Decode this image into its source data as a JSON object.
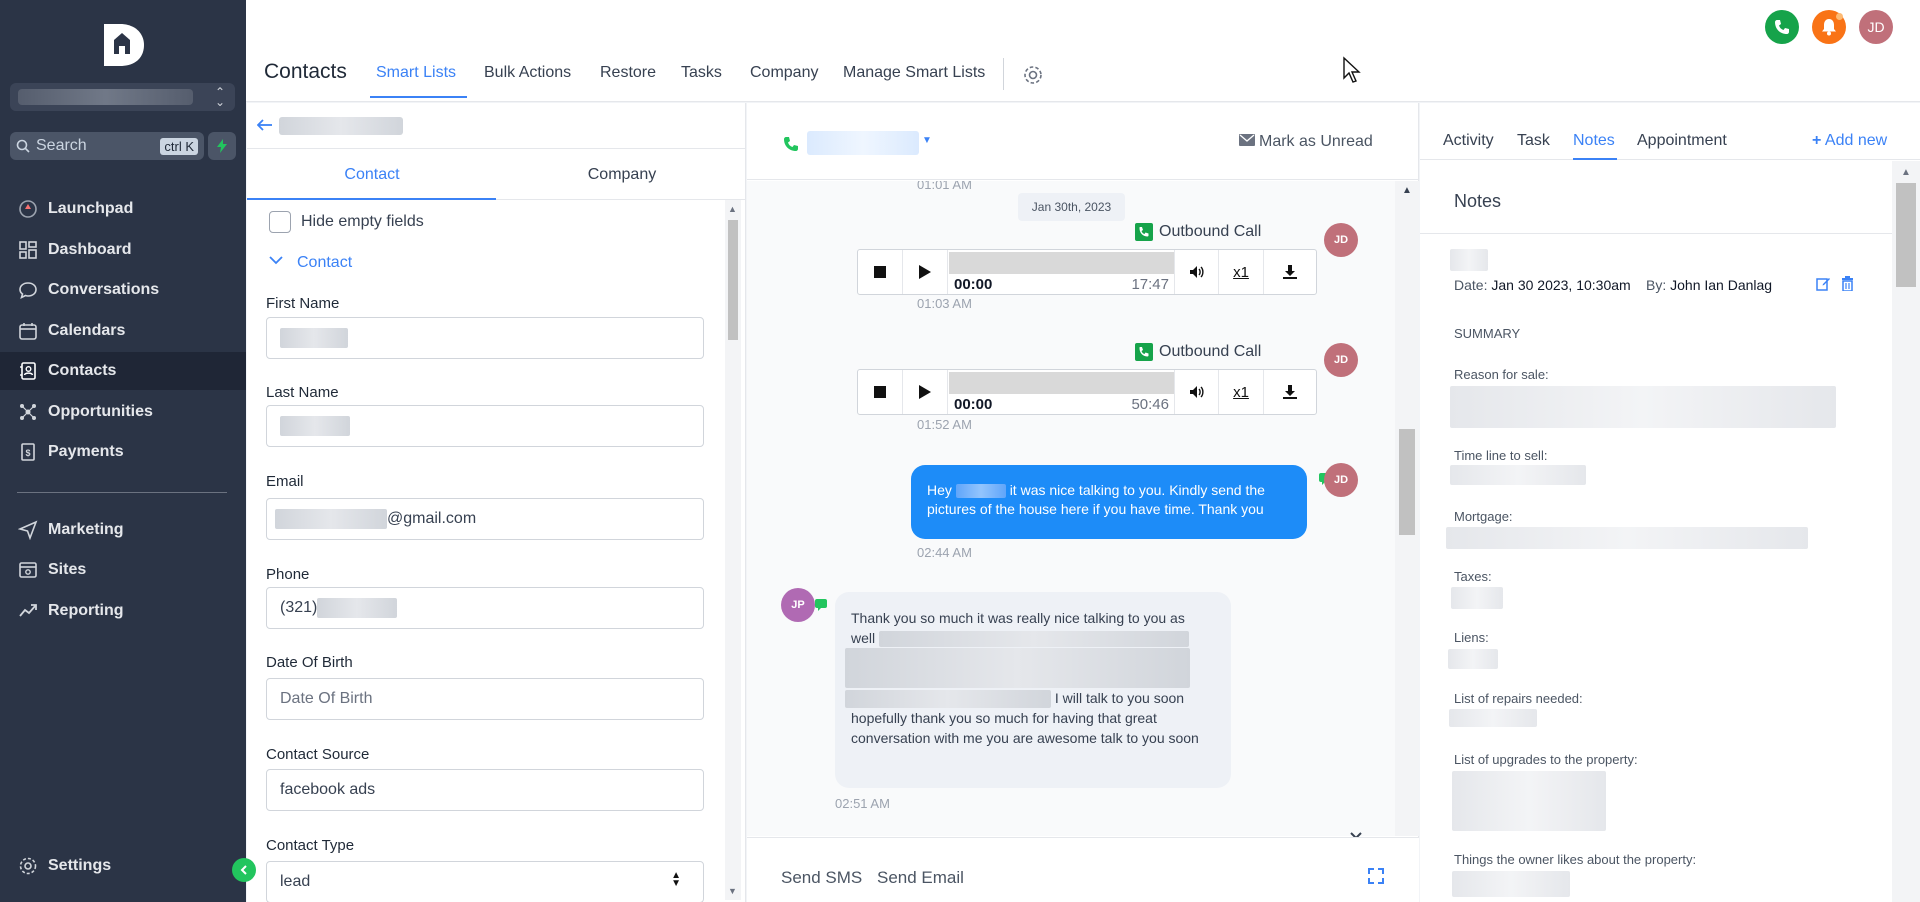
{
  "sidebar": {
    "search_placeholder": "Search",
    "search_shortcut": "ctrl K",
    "items": [
      {
        "label": "Launchpad",
        "icon": "launchpad-icon"
      },
      {
        "label": "Dashboard",
        "icon": "dashboard-icon"
      },
      {
        "label": "Conversations",
        "icon": "chat-icon"
      },
      {
        "label": "Calendars",
        "icon": "calendar-icon"
      },
      {
        "label": "Contacts",
        "icon": "contacts-icon",
        "active": true
      },
      {
        "label": "Opportunities",
        "icon": "opportunities-icon"
      },
      {
        "label": "Payments",
        "icon": "payments-icon"
      },
      {
        "label": "Marketing",
        "icon": "marketing-icon"
      },
      {
        "label": "Sites",
        "icon": "sites-icon"
      },
      {
        "label": "Reporting",
        "icon": "reporting-icon"
      }
    ],
    "settings_label": "Settings"
  },
  "header": {
    "title": "Contacts",
    "tabs": [
      "Smart Lists",
      "Bulk Actions",
      "Restore",
      "Tasks",
      "Company",
      "Manage Smart Lists"
    ],
    "active_tab": "Smart Lists",
    "user_initials": "JD",
    "colors": {
      "phone": "#16a34a",
      "bell": "#f97316",
      "avatar": "#c0707a"
    }
  },
  "contact_panel": {
    "tabs": [
      "Contact",
      "Company"
    ],
    "hide_empty_label": "Hide empty fields",
    "section_label": "Contact",
    "fields": {
      "first_name_label": "First Name",
      "last_name_label": "Last Name",
      "email_label": "Email",
      "email_suffix": "@gmail.com",
      "phone_label": "Phone",
      "phone_prefix": "(321)",
      "dob_label": "Date Of Birth",
      "dob_placeholder": "Date Of Birth",
      "source_label": "Contact Source",
      "source_value": "facebook ads",
      "type_label": "Contact Type",
      "type_value": "lead"
    }
  },
  "conversation": {
    "mark_unread": "Mark as Unread",
    "date_divider": "Jan 30th, 2023",
    "top_time": "01:01 AM",
    "calls": [
      {
        "label": "Outbound Call",
        "current": "00:00",
        "duration": "17:47",
        "speed": "x1",
        "time": "01:03 AM"
      },
      {
        "label": "Outbound Call",
        "current": "00:00",
        "duration": "50:46",
        "speed": "x1",
        "time": "01:52 AM"
      }
    ],
    "outgoing": {
      "text_a": "Hey",
      "text_b": "it was nice talking to you. Kindly send the",
      "text_c": "pictures of the house here if you have time. Thank you",
      "time": "02:44 AM"
    },
    "incoming": {
      "line1": "Thank you so much it was really nice talking to you as",
      "line2": "well",
      "line3": "I will talk to you soon",
      "line4": "hopefully thank you so much for having that great",
      "line5": "conversation with me you are awesome talk to you soon",
      "time": "02:51 AM",
      "initials": "JP"
    },
    "footer_tabs": [
      "Send SMS",
      "Send Email"
    ]
  },
  "notes_panel": {
    "tabs": [
      "Activity",
      "Task",
      "Notes",
      "Appointment"
    ],
    "active_tab": "Notes",
    "add_new": "Add new",
    "title": "Notes",
    "date_label": "Date:",
    "date_value": "Jan 30 2023, 10:30am",
    "by_label": "By:",
    "by_value": "John Ian Danlag",
    "summary": "SUMMARY",
    "labels": [
      "Reason for sale:",
      "Time line to sell:",
      "Mortgage:",
      "Taxes:",
      "Liens:",
      "List of repairs needed:",
      "List of upgrades to the property:",
      "Things the owner likes about the property:"
    ]
  }
}
